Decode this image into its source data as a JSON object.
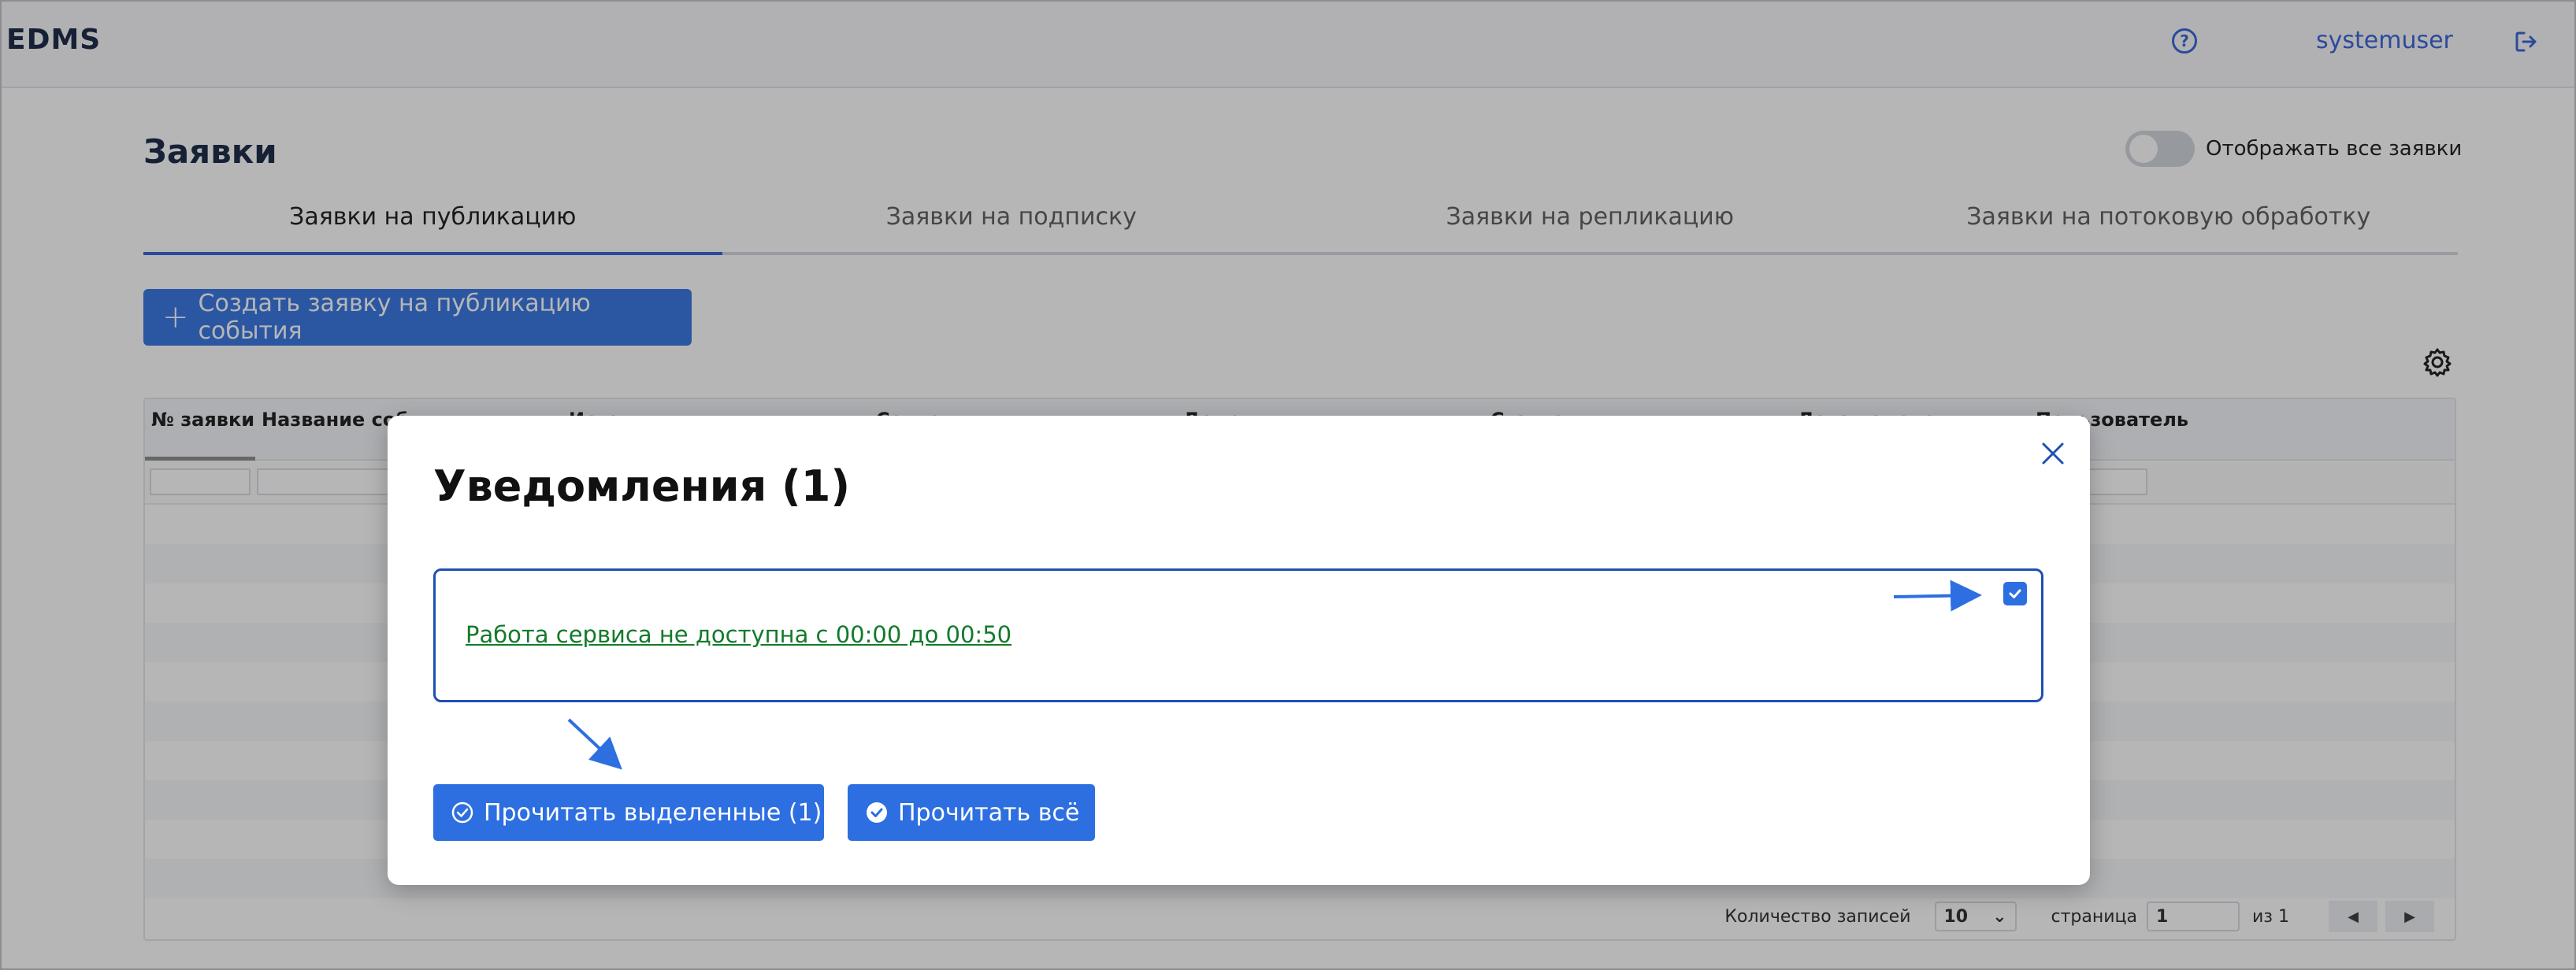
{
  "app": {
    "logo": "EDMS",
    "username": "systemuser"
  },
  "header": {
    "help_icon": "question-circle-icon",
    "logout_icon": "logout-icon"
  },
  "page": {
    "title": "Заявки",
    "toggle_label": "Отображать все заявки",
    "toggle_on": false,
    "tabs": [
      {
        "label": "Заявки на публикацию",
        "active": true
      },
      {
        "label": "Заявки на подписку",
        "active": false
      },
      {
        "label": "Заявки на репликацию",
        "active": false
      },
      {
        "label": "Заявки на потоковую обработку",
        "active": false
      }
    ],
    "create_button": "Создать заявку на публикацию события",
    "settings_icon": "gear-icon"
  },
  "table": {
    "columns": [
      "№ заявки",
      "Название события",
      "Источник",
      "Сегмент",
      "Домен",
      "Статус",
      "Дата изменения",
      "Пользователь"
    ],
    "pager": {
      "records_label": "Количество записей",
      "page_size": "10",
      "page_label": "страница",
      "page": "1",
      "of_label": "из 1",
      "prev": "◀",
      "next": "▶"
    }
  },
  "modal": {
    "title": "Уведомления (1)",
    "notification_text": "Работа сервиса не доступна с 00:00 до 00:50",
    "notification_checked": true,
    "read_selected_button": "Прочитать выделенные (1)",
    "read_all_button": "Прочитать всё",
    "close_icon": "close-icon"
  },
  "colors": {
    "accent": "#2d6fe0",
    "link_green": "#137a2b",
    "card_border": "#1f4fb3",
    "overlay": "rgba(40,40,45,0.34)"
  }
}
